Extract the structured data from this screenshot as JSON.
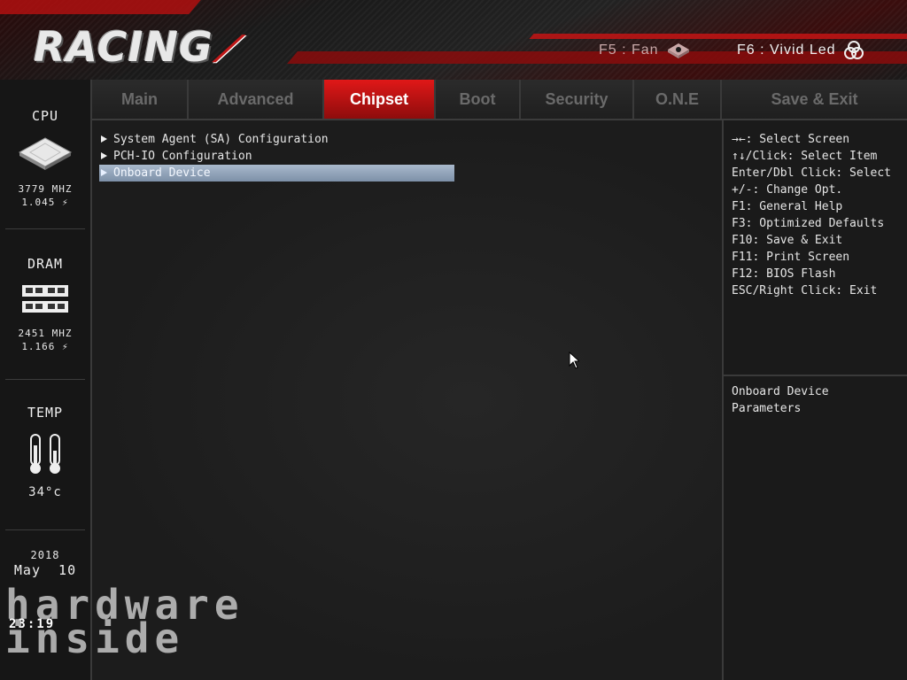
{
  "header": {
    "logo_text": "RACING",
    "fan_hotkey": "F5 : Fan",
    "led_hotkey": "F6 : Vivid Led"
  },
  "sidebar": {
    "cpu": {
      "title": "CPU",
      "freq": "3779 MHZ",
      "volt": "1.045 ⚡"
    },
    "dram": {
      "title": "DRAM",
      "freq": "2451 MHZ",
      "volt": "1.166 ⚡"
    },
    "temp": {
      "title": "TEMP",
      "value": "34°c"
    },
    "date": {
      "year": "2018",
      "month_day": "May  10"
    }
  },
  "tabs": [
    {
      "label": "Main"
    },
    {
      "label": "Advanced"
    },
    {
      "label": "Chipset",
      "active": true
    },
    {
      "label": "Boot"
    },
    {
      "label": "Security"
    },
    {
      "label": "O.N.E"
    },
    {
      "label": "Save & Exit"
    }
  ],
  "menu": [
    {
      "label": "System Agent (SA) Configuration"
    },
    {
      "label": "PCH-IO Configuration"
    },
    {
      "label": "Onboard Device",
      "selected": true
    }
  ],
  "help": {
    "keys": [
      "→←: Select Screen",
      "↑↓/Click: Select Item",
      "Enter/Dbl Click: Select",
      "+/-: Change Opt.",
      "F1: General Help",
      "F3: Optimized Defaults",
      "F10: Save & Exit",
      "F11: Print Screen",
      "F12: BIOS Flash",
      "ESC/Right Click: Exit"
    ],
    "description_line1": "Onboard Device",
    "description_line2": "Parameters"
  },
  "watermark": {
    "line1": "hardware",
    "line2": "inside",
    "clock": "23:19"
  },
  "colors": {
    "accent": "#c01818",
    "selection": "#8fa2b8",
    "background": "#1c1c1c"
  }
}
